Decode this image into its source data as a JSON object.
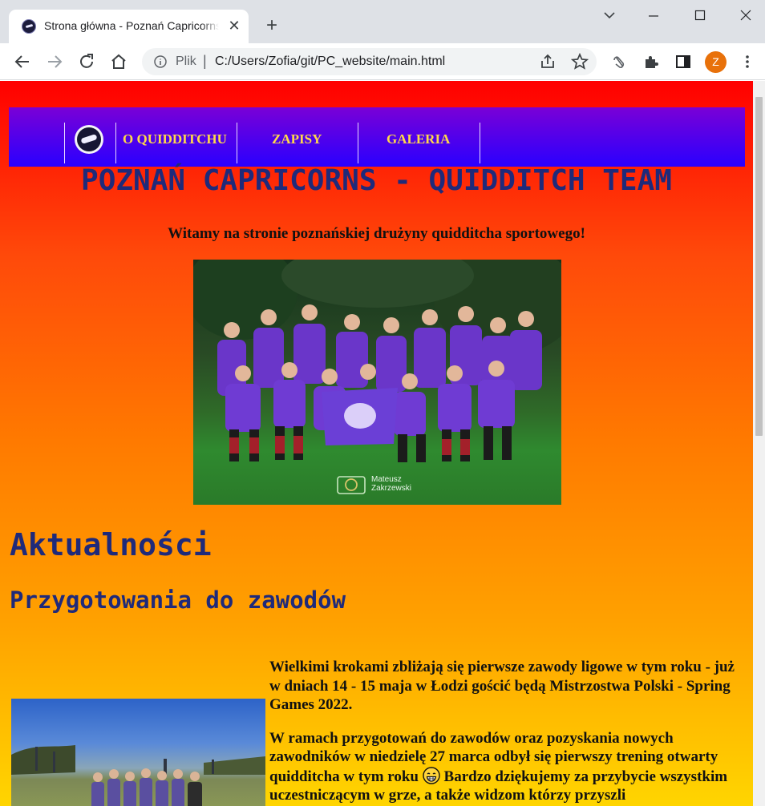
{
  "browser": {
    "tab_title": "Strona główna - Poznań Capricorns",
    "new_tab_label": "+",
    "close_tab_label": "✕",
    "scheme_label": "Plik",
    "scheme_separator": "|",
    "url": "C:/Users/Zofia/git/PC_website/main.html",
    "profile_initial": "Z",
    "icons": [
      "back-icon",
      "forward-icon",
      "reload-icon",
      "home-icon",
      "info-icon",
      "share-icon",
      "star-icon",
      "extension-hand-icon",
      "puzzle-icon",
      "sidepanel-icon",
      "menu-icon"
    ]
  },
  "page": {
    "colors": {
      "bg_top": "#ff0000",
      "bg_bottom": "#ffd500",
      "nav_top": "#7a00d6",
      "nav_bottom": "#2a00ff",
      "nav_text": "#ffd84a",
      "heading": "#1f2a7a"
    },
    "nav": {
      "links": [
        {
          "label": "O QUIDDITCHU"
        },
        {
          "label": "ZAPISY"
        },
        {
          "label": "GALERIA"
        }
      ]
    },
    "title": "POZNAŃ CAPRICORNS - QUIDDITCH TEAM",
    "welcome": "Witamy na stronie poznańskiej drużyny quidditcha sportowego!",
    "team_photo": {
      "credit_line1": "Mateusz",
      "credit_line2": "Zakrzewski"
    },
    "news_heading": "Aktualności",
    "article": {
      "heading": "Przygotowania do zawodów",
      "paragraph1": "Wielkimi krokami zbliżają się pierwsze zawody ligowe w tym roku - już w dniach 14 - 15 maja w Łodzi gościć będą Mistrzostwa Polski - Spring Games 2022.",
      "paragraph2_before": "W ramach przygotowań do zawodów oraz pozyskania nowych zawodników w niedzielę 27 marca odbył się pierwszy trening otwarty quidditcha w tym roku",
      "paragraph2_after": "Bardzo dziękujemy za przybycie wszystkim uczestniczącym w grze, a także widzom którzy przyszli"
    }
  }
}
